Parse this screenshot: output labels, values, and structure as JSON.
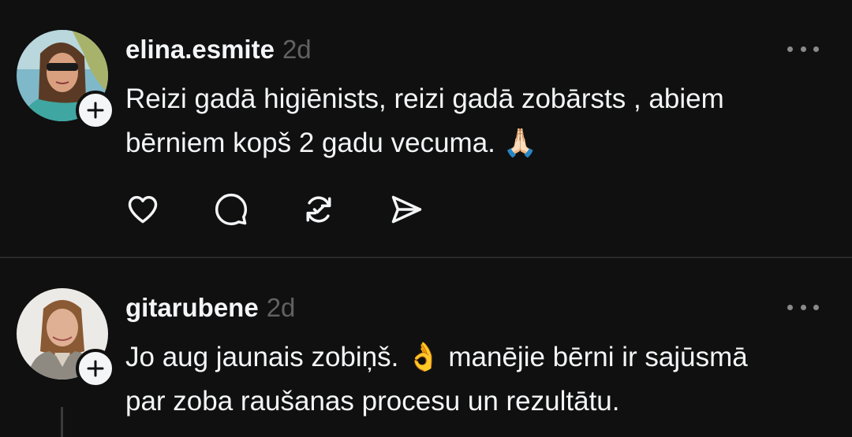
{
  "posts": [
    {
      "username": "elina.esmite",
      "time": "2d",
      "text_lines": [
        "Reizi gadā higiēnists, reizi gadā zobārsts , abiem",
        "bērniem  kopš 2 gadu vecuma. 🙏🏻"
      ],
      "actions": [
        "heart-icon",
        "comment-icon",
        "repost-icon",
        "share-icon"
      ]
    },
    {
      "username": "gitarubene",
      "time": "2d",
      "text_lines": [
        "Jo aug jaunais zobiņš. 👌 manējie bērni ir sajūsmā",
        "par zoba raušanas procesu un rezultātu."
      ]
    }
  ],
  "colors": {
    "background": "#101010",
    "text": "#f3f5f7",
    "muted": "#616161",
    "divider": "#2a2a2a"
  }
}
